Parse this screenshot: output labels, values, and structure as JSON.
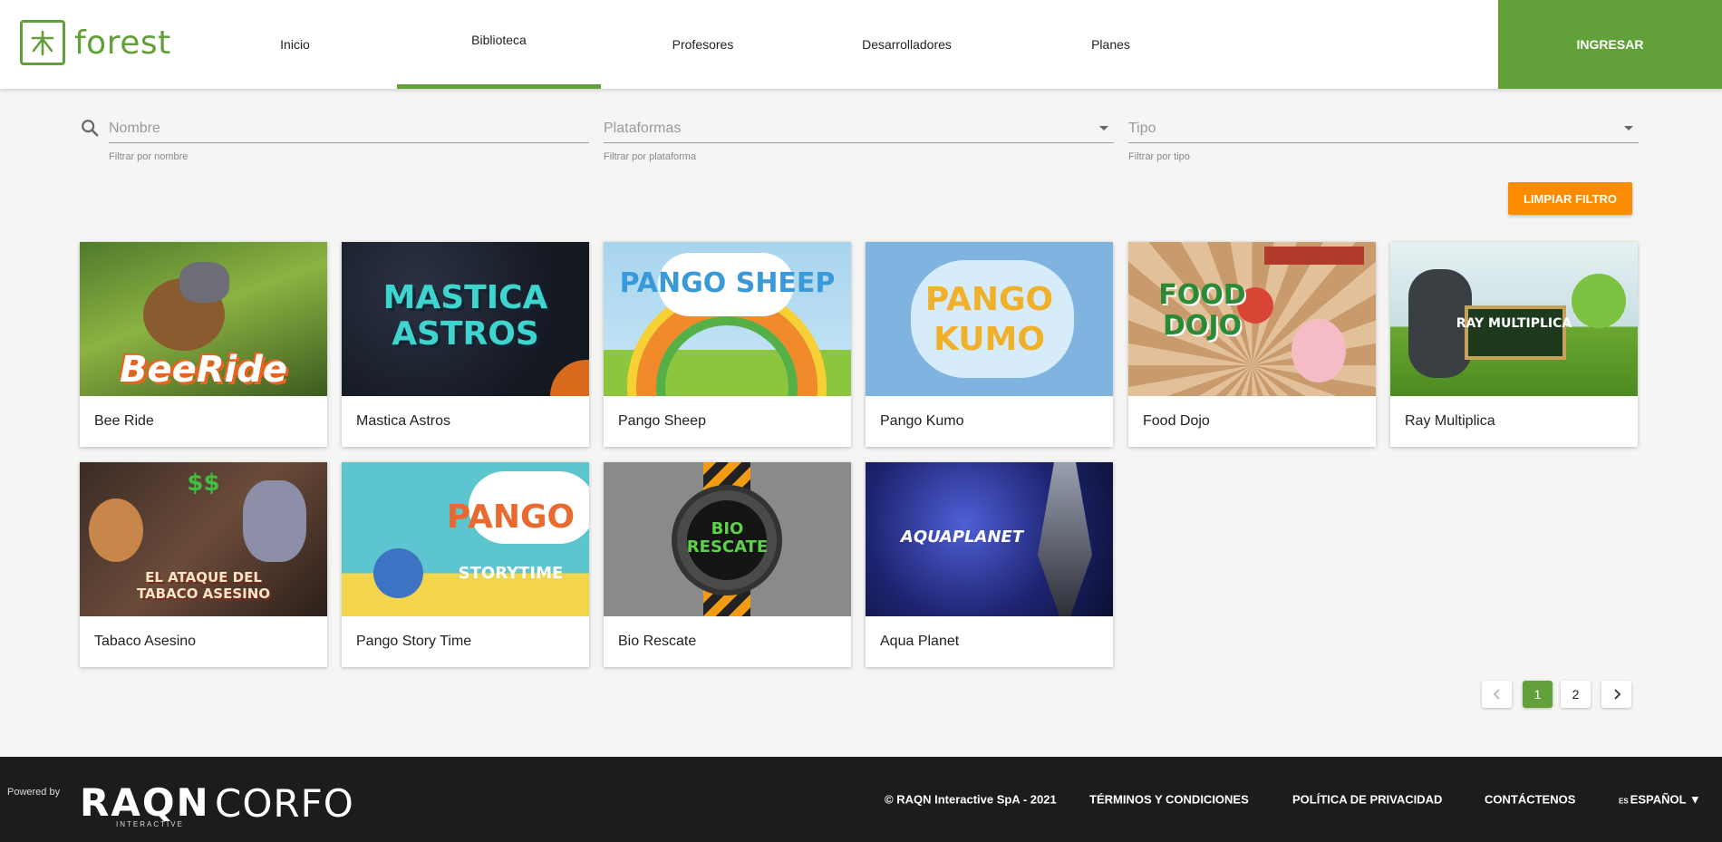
{
  "header": {
    "logo_text": "forest",
    "nav": [
      "Inicio",
      "Biblioteca",
      "Profesores",
      "Desarrolladores",
      "Planes"
    ],
    "active_nav": "Biblioteca",
    "login_label": "INGRESAR"
  },
  "filters": {
    "name": {
      "placeholder": "Nombre",
      "hint": "Filtrar por nombre"
    },
    "platform": {
      "placeholder": "Plataformas",
      "hint": "Filtrar por plataforma"
    },
    "type": {
      "placeholder": "Tipo",
      "hint": "Filtrar por tipo"
    },
    "clear_label": "LIMPIAR FILTRO"
  },
  "games": [
    {
      "title": "Bee Ride",
      "art_text": "BeeRide"
    },
    {
      "title": "Mastica Astros",
      "art_text": "MASTICA ASTROS"
    },
    {
      "title": "Pango Sheep",
      "art_text": "PANGO SHEEP"
    },
    {
      "title": "Pango Kumo",
      "art_text": "PANGO KUMO"
    },
    {
      "title": "Food Dojo",
      "art_text": "FOOD DOJO"
    },
    {
      "title": "Ray Multiplica",
      "art_text": "RAY MULTIPLICA"
    },
    {
      "title": "Tabaco Asesino",
      "art_text": "EL ATAQUE DEL TABACO ASESINO"
    },
    {
      "title": "Pango Story Time",
      "art_text": "PANGO STORYTIME"
    },
    {
      "title": "Bio Rescate",
      "art_text": "BIO RESCATE"
    },
    {
      "title": "Aqua Planet",
      "art_text": "AQUAPLANET"
    }
  ],
  "pagination": {
    "pages": [
      "1",
      "2"
    ],
    "current": "1"
  },
  "footer": {
    "powered_by": "Powered by",
    "raqn": "RAQN",
    "raqn_sub": "INTERACTIVE",
    "corfo": "CORFO",
    "copyright": "© RAQN Interactive SpA - 2021",
    "terms": "TÉRMINOS Y CONDICIONES",
    "privacy": "POLÍTICA DE PRIVACIDAD",
    "contact": "CONTÁCTENOS",
    "lang_code": "ES",
    "lang_label": "ESPAÑOL ▼"
  },
  "colors": {
    "brand_green": "#62a03a",
    "accent_orange": "#fb8c00",
    "footer_bg": "#1c1c1c"
  }
}
